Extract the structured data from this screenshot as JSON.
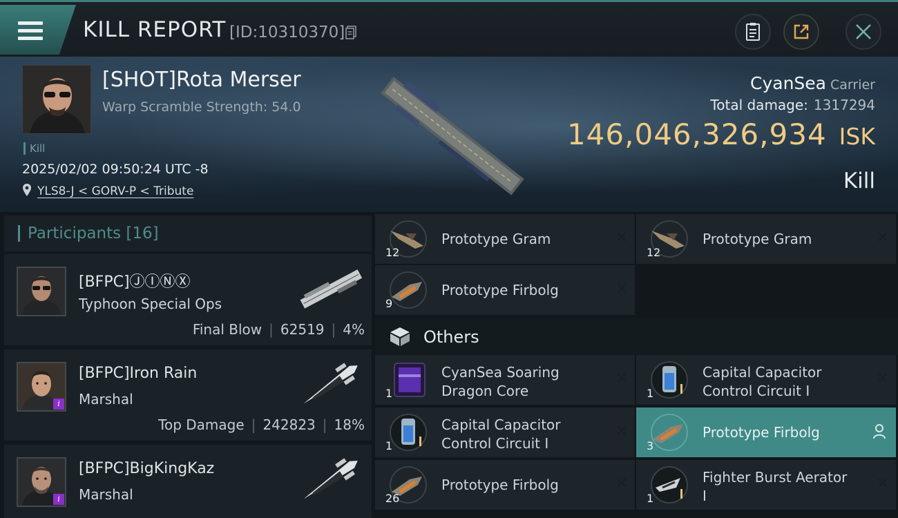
{
  "header": {
    "title": "KILL REPORT",
    "report_id": "[ID:10310370]"
  },
  "victim": {
    "name": "[SHOT]Rota Merser",
    "warp_scramble": "Warp Scramble Strength: 54.0",
    "kill_tag": "Kill",
    "timestamp": "2025/02/02 09:50:24 UTC -8",
    "location": "YLS8-J < GORV-P < Tribute",
    "corp": "CyanSea",
    "ship_class": "Carrier",
    "total_damage_label": "Total damage:",
    "total_damage": "1317294",
    "isk_value": "146,046,326,934",
    "isk_unit": "ISK",
    "kill_type": "Kill"
  },
  "participants": {
    "title": "Participants",
    "count": "[16]",
    "items": [
      {
        "name": "[BFPC]ⒿⒾⓃⓍ",
        "ship": "Typhoon Special Ops",
        "role": "Final Blow",
        "damage": "62519",
        "percent": "4%",
        "badge": false
      },
      {
        "name": "[BFPC]Iron Rain",
        "ship": "Marshal",
        "role": "Top Damage",
        "damage": "242823",
        "percent": "18%",
        "badge": true
      },
      {
        "name": "[BFPC]BigKingKaz",
        "ship": "Marshal",
        "role": "",
        "damage": "",
        "percent": "",
        "badge": true
      }
    ]
  },
  "items": {
    "top": [
      {
        "name": "Prototype Gram",
        "qty": "12"
      },
      {
        "name": "Prototype Gram",
        "qty": "12"
      },
      {
        "name": "Prototype Firbolg",
        "qty": "9"
      }
    ],
    "others_title": "Others",
    "others": [
      {
        "name_line1": "CyanSea Soaring",
        "name_line2": "Dragon Core",
        "qty": "1"
      },
      {
        "name_line1": "Capital Capacitor",
        "name_line2": "Control Circuit I",
        "qty": "1"
      },
      {
        "name_line1": "Capital Capacitor",
        "name_line2": "Control Circuit I",
        "qty": "1"
      },
      {
        "name_line1": "Prototype Firbolg",
        "name_line2": "",
        "qty": "3",
        "selected": true
      },
      {
        "name_line1": "Prototype Firbolg",
        "name_line2": "",
        "qty": "26"
      },
      {
        "name_line1": "Fighter Burst Aerator",
        "name_line2": "I",
        "qty": "1"
      }
    ],
    "close_glyph": "✕"
  },
  "colors": {
    "accent": "#4e8d8a",
    "isk": "#f0cb84",
    "selected_row": "#3f8a86",
    "badge": "#8b2fc9"
  },
  "icons": [
    "menu-icon",
    "copy-icon",
    "notes-icon",
    "share-icon",
    "close-icon",
    "location-pin-icon",
    "cube-icon",
    "user-icon"
  ]
}
